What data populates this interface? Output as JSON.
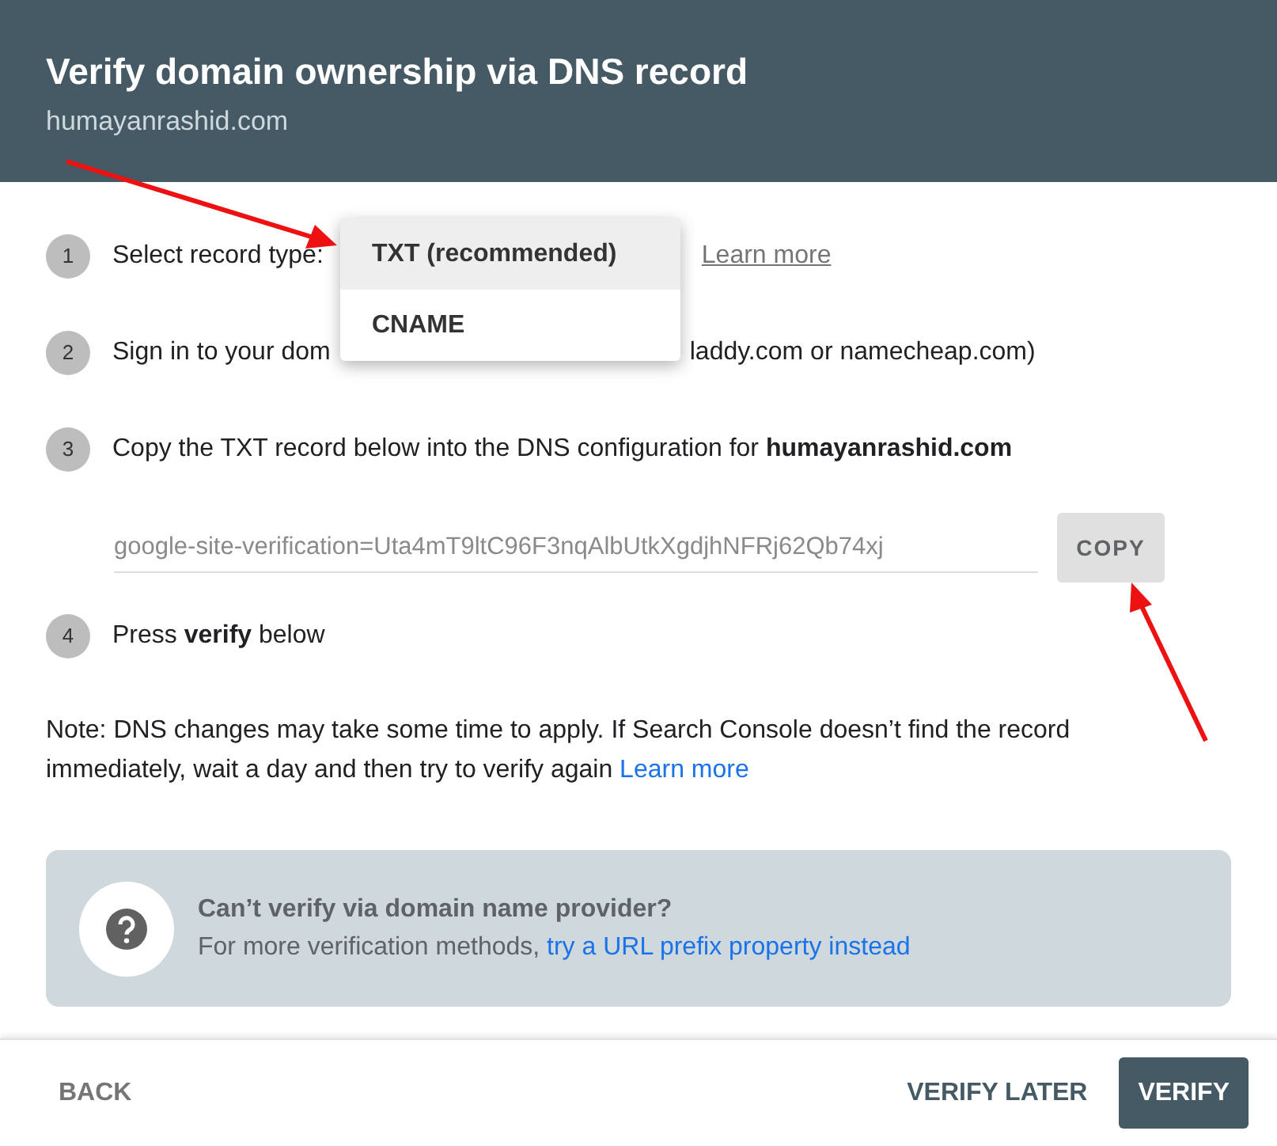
{
  "header": {
    "title": "Verify domain ownership via DNS record",
    "subtitle": "humayanrashid.com"
  },
  "steps": [
    {
      "number": "1",
      "kind": "select",
      "label": "Select record type:",
      "link": "Learn more"
    },
    {
      "number": "2",
      "kind": "covered",
      "text_before": "Sign in to your dom",
      "text_after": "laddy.com or namecheap.com)"
    },
    {
      "number": "3",
      "kind": "record",
      "text": "Copy the TXT record below into the DNS configuration for **humayanrashid.com**",
      "record": "google-site-verification=Uta4mT9ltC96F3nqAlbUtkXgdjhNFRj62Qb74xj",
      "copy_button": "COPY"
    },
    {
      "number": "4",
      "kind": "text",
      "text": "Press **verify** below"
    }
  ],
  "record_type_menu": [
    {
      "label": "TXT (recommended)",
      "selected": true
    },
    {
      "label": "CNAME",
      "selected": false
    }
  ],
  "note": {
    "text": "Note: DNS changes may take some time to apply. If Search Console doesn’t find the record immediately, wait a day and then try to verify again",
    "link": "Learn more"
  },
  "help": {
    "title": "Can’t verify via domain name provider?",
    "text": "For more verification methods,",
    "link": "try a URL prefix property instead"
  },
  "footer": {
    "back": "BACK",
    "verify_later": "VERIFY LATER",
    "verify": "VERIFY"
  }
}
